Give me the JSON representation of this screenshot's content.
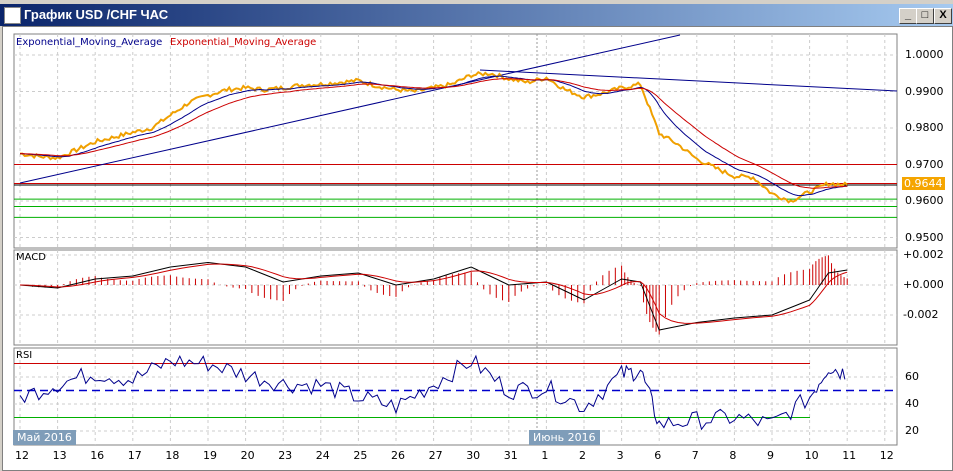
{
  "window": {
    "title": "График USD /CHF  ЧАС",
    "minimize": "_",
    "maximize": "□",
    "close": "X"
  },
  "legend": {
    "ema1": "Exponential_Moving_Average",
    "ema2": "Exponential_Moving_Average"
  },
  "current_price": "0.9644",
  "colors": {
    "price": "#f0a000",
    "ema_fast": "#00008b",
    "ema_slow": "#cc0000",
    "green": "#00b000"
  },
  "panels": {
    "macd": "MACD",
    "rsi": "RSI"
  },
  "price_axis": [
    "1.0000",
    "0.9900",
    "0.9800",
    "0.9700",
    "0.9600",
    "0.9500"
  ],
  "macd_axis": [
    "+0.002",
    "+0.000",
    "-0.002"
  ],
  "rsi_axis": [
    "60",
    "40",
    "20"
  ],
  "months": [
    "Май 2016",
    "Июнь 2016"
  ],
  "days": [
    "12",
    "13",
    "16",
    "17",
    "18",
    "19",
    "20",
    "23",
    "24",
    "25",
    "26",
    "27",
    "30",
    "31",
    "1",
    "2",
    "3",
    "6",
    "7",
    "8",
    "9",
    "10",
    "11",
    "12"
  ],
  "chart_data": {
    "type": "line",
    "price_levels": {
      "red": [
        0.97,
        0.9648
      ],
      "black": 0.9644,
      "green": [
        0.9605,
        0.9585,
        0.9555
      ]
    },
    "price": [
      [
        0,
        0.973
      ],
      [
        0.5,
        0.9722
      ],
      [
        1,
        0.9718
      ],
      [
        1.5,
        0.974
      ],
      [
        2,
        0.9762
      ],
      [
        2.5,
        0.9775
      ],
      [
        3,
        0.9788
      ],
      [
        3.5,
        0.98
      ],
      [
        4,
        0.9835
      ],
      [
        4.5,
        0.987
      ],
      [
        5,
        0.989
      ],
      [
        5.5,
        0.9905
      ],
      [
        6,
        0.991
      ],
      [
        6.5,
        0.9905
      ],
      [
        7,
        0.991
      ],
      [
        7.5,
        0.9918
      ],
      [
        8,
        0.992
      ],
      [
        8.5,
        0.9925
      ],
      [
        9,
        0.993
      ],
      [
        9.5,
        0.9915
      ],
      [
        10,
        0.9905
      ],
      [
        10.5,
        0.99
      ],
      [
        11,
        0.991
      ],
      [
        11.5,
        0.992
      ],
      [
        12,
        0.9945
      ],
      [
        12.5,
        0.995
      ],
      [
        13,
        0.9935
      ],
      [
        13.5,
        0.9925
      ],
      [
        14,
        0.9938
      ],
      [
        14.5,
        0.9905
      ],
      [
        15,
        0.9885
      ],
      [
        15.5,
        0.9895
      ],
      [
        16,
        0.991
      ],
      [
        16.5,
        0.992
      ],
      [
        17,
        0.9785
      ],
      [
        17.5,
        0.9755
      ],
      [
        18,
        0.9715
      ],
      [
        18.5,
        0.969
      ],
      [
        19,
        0.9668
      ],
      [
        19.5,
        0.9665
      ],
      [
        20,
        0.962
      ],
      [
        20.5,
        0.96
      ],
      [
        21,
        0.9625
      ],
      [
        21.5,
        0.9648
      ],
      [
        22,
        0.9644
      ]
    ],
    "macd": [
      [
        0,
        0.0
      ],
      [
        1,
        -0.0002
      ],
      [
        2,
        0.0004
      ],
      [
        3,
        0.0006
      ],
      [
        4,
        0.0012
      ],
      [
        5,
        0.0015
      ],
      [
        6,
        0.0012
      ],
      [
        7,
        0.0002
      ],
      [
        8,
        0.0006
      ],
      [
        9,
        0.0008
      ],
      [
        10,
        0.0
      ],
      [
        11,
        0.0004
      ],
      [
        12,
        0.0012
      ],
      [
        13,
        0.0
      ],
      [
        14,
        0.0002
      ],
      [
        15,
        -0.001
      ],
      [
        16,
        0.0004
      ],
      [
        16.5,
        0.0002
      ],
      [
        17,
        -0.003
      ],
      [
        18,
        -0.0025
      ],
      [
        19,
        -0.0022
      ],
      [
        20,
        -0.002
      ],
      [
        21,
        -0.001
      ],
      [
        21.5,
        0.0008
      ],
      [
        22,
        0.001
      ]
    ],
    "rsi": [
      [
        0,
        45
      ],
      [
        1,
        55
      ],
      [
        2,
        63
      ],
      [
        3,
        58
      ],
      [
        4,
        72
      ],
      [
        5,
        70
      ],
      [
        6,
        62
      ],
      [
        7,
        55
      ],
      [
        8,
        54
      ],
      [
        9,
        45
      ],
      [
        10,
        38
      ],
      [
        11,
        55
      ],
      [
        12,
        72
      ],
      [
        13,
        50
      ],
      [
        14,
        52
      ],
      [
        15,
        38
      ],
      [
        16,
        62
      ],
      [
        16.5,
        65
      ],
      [
        17,
        25
      ],
      [
        18,
        28
      ],
      [
        19,
        30
      ],
      [
        20,
        25
      ],
      [
        21,
        45
      ],
      [
        21.5,
        68
      ],
      [
        22,
        62
      ]
    ],
    "rsi_levels": [
      70,
      50,
      30
    ]
  }
}
